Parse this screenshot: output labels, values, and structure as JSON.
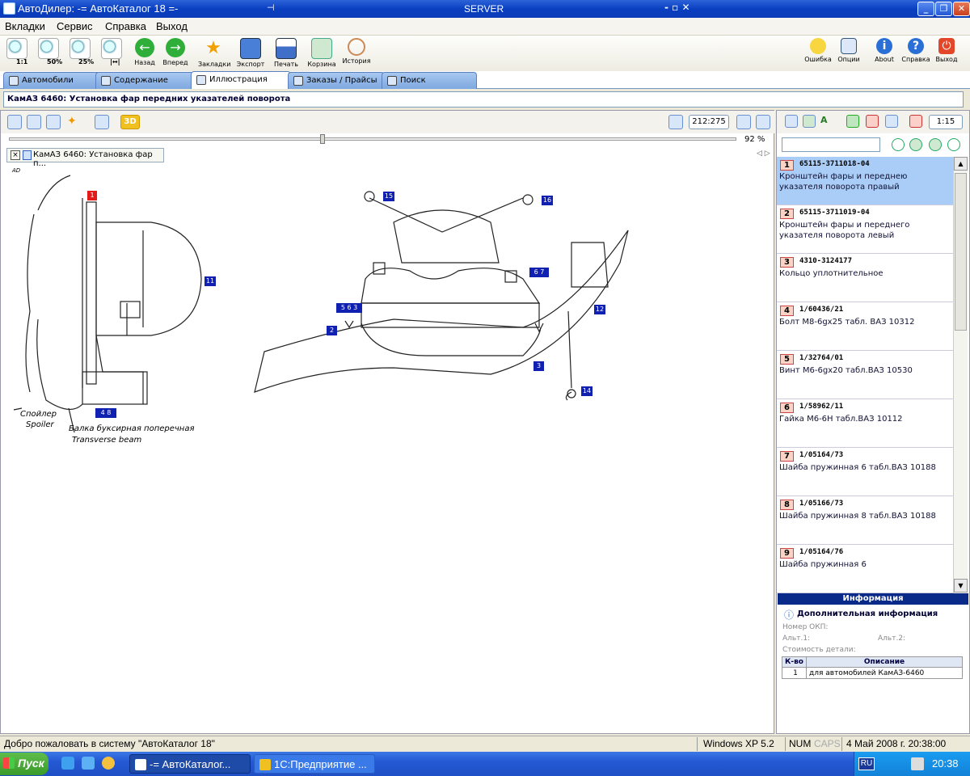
{
  "window": {
    "title": "АвтоДилер: -= АвтоКаталог 18 =-",
    "server": "SERVER"
  },
  "menu": [
    "Вкладки",
    "Сервис",
    "Справка",
    "Выход"
  ],
  "toolbar": {
    "left": [
      {
        "label": "",
        "icon": "zoom-1to1-icon",
        "overlay": "1:1"
      },
      {
        "label": "",
        "icon": "zoom-50-icon",
        "overlay": "50%"
      },
      {
        "label": "",
        "icon": "zoom-25-icon",
        "overlay": "25%"
      },
      {
        "label": "",
        "icon": "zoom-fit-icon",
        "overlay": "|↔|"
      },
      {
        "label": "Назад",
        "icon": "back-arrow-icon"
      },
      {
        "label": "Вперед",
        "icon": "forward-arrow-icon"
      },
      {
        "label": "Закладки",
        "icon": "bookmark-star-icon"
      },
      {
        "label": "Экспорт",
        "icon": "export-icon"
      },
      {
        "label": "Печать",
        "icon": "print-icon"
      },
      {
        "label": "Корзина",
        "icon": "cart-icon"
      },
      {
        "label": "История",
        "icon": "history-icon"
      }
    ],
    "right": [
      {
        "label": "Ошибка",
        "icon": "error-face-icon"
      },
      {
        "label": "Опции",
        "icon": "options-icon"
      },
      {
        "label": "About",
        "icon": "info-icon"
      },
      {
        "label": "Справка",
        "icon": "help-icon"
      },
      {
        "label": "Выход",
        "icon": "exit-icon"
      }
    ]
  },
  "tabs": [
    "Автомобили",
    "Содержание",
    "Иллюстрация",
    "Заказы / Прайсы",
    "Поиск"
  ],
  "active_tab": "Иллюстрация",
  "page_header": "КамАЗ 6460: Установка фар передних указателей поворота",
  "illustration": {
    "coord": "212:275",
    "zoom": "92 %",
    "doc_tab": "КамАЗ 6460: Установка фар п...",
    "drawing": {
      "corner_label": "AD",
      "label_spoiler_ru": "Спойлер",
      "label_spoiler_en": "Spoiler",
      "label_beam_ru": "Балка буксирная поперечная",
      "label_beam_en": "Transverse beam",
      "callouts": [
        "1",
        "11",
        "4 8",
        "15",
        "16",
        "5 6 3",
        "6 7",
        "2",
        "12",
        "3",
        "14"
      ]
    }
  },
  "right_panel": {
    "scale": "1:15",
    "search_value": "",
    "parts": [
      {
        "num": "1",
        "code": "65115-3711018-04",
        "desc": "Кронштейн фары и переднею указателя поворота правый",
        "selected": true
      },
      {
        "num": "2",
        "code": "65115-3711019-04",
        "desc": "Кронштейн фары и переднего указателя поворота левый"
      },
      {
        "num": "3",
        "code": "4310-3124177",
        "desc": "Кольцо уплотнительное"
      },
      {
        "num": "4",
        "code": "1/60436/21",
        "desc": "Болт М8-6gх25 табл. ВАЗ 10312"
      },
      {
        "num": "5",
        "code": "1/32764/01",
        "desc": "Винт М6-6gх20 табл.ВАЗ 10530"
      },
      {
        "num": "6",
        "code": "1/58962/11",
        "desc": "Гайка М6-6Н табл.ВАЗ 10112"
      },
      {
        "num": "7",
        "code": "1/05164/73",
        "desc": "Шайба пружинная 6 табл.ВАЗ 10188"
      },
      {
        "num": "8",
        "code": "1/05166/73",
        "desc": "Шайба пружинная 8 табл.ВАЗ 10188"
      },
      {
        "num": "9",
        "code": "1/05164/76",
        "desc": "Шайба пружинная 6"
      }
    ],
    "info": {
      "header": "Информация",
      "subheader": "Дополнительная информация",
      "okp_label": "Номер ОКП:",
      "alt1_label": "Альт.1:",
      "alt2_label": "Альт.2:",
      "cost_label": "Стоимость детали:",
      "col_qty": "К-во",
      "col_desc": "Описание",
      "row": {
        "qty": "1",
        "desc": "для автомобилей КамАЗ-6460"
      }
    }
  },
  "status": {
    "message": "Добро пожаловать в систему \"АвтоКаталог 18\"",
    "os": "Windows XP 5.2",
    "num": "NUM",
    "caps": "CAPS",
    "datetime": "4 Май 2008 г. 20:38:00"
  },
  "taskbar": {
    "start": "Пуск",
    "tasks": [
      "-= АвтоКаталог...",
      "1С:Предприятие ..."
    ],
    "lang": "RU",
    "clock": "20:38"
  }
}
